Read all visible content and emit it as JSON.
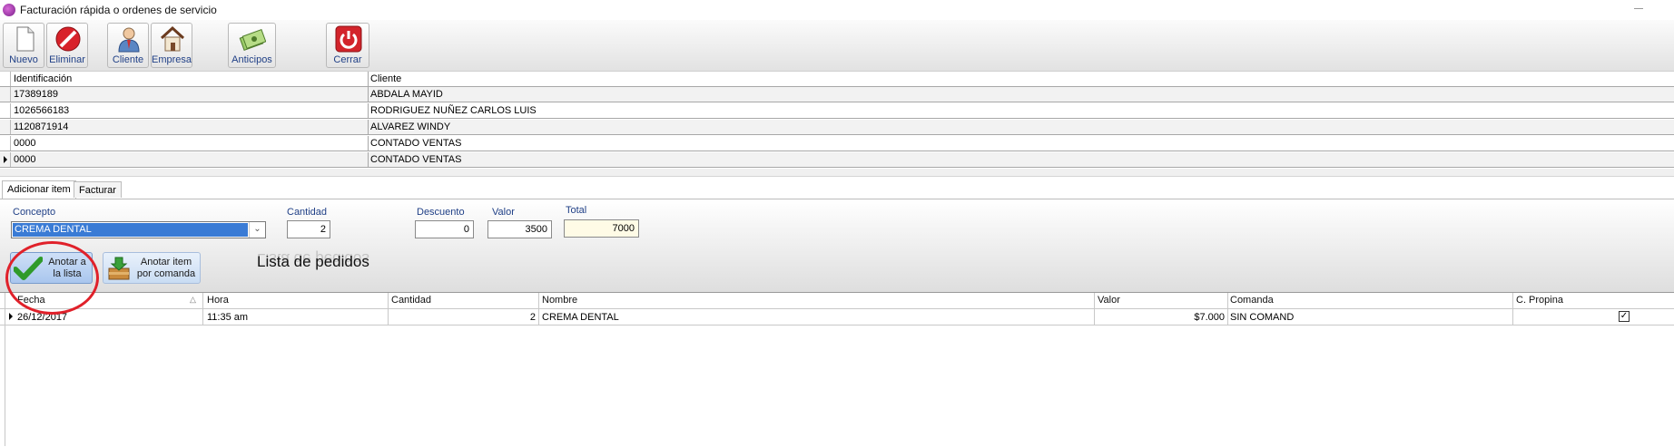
{
  "window": {
    "title": "Facturación rápida o ordenes de servicio"
  },
  "toolbar": {
    "items": [
      {
        "label": "Nuevo",
        "icon": "new-document-icon"
      },
      {
        "label": "Eliminar",
        "icon": "delete-icon"
      },
      {
        "label": "Cliente",
        "icon": "client-icon"
      },
      {
        "label": "Empresa",
        "icon": "company-icon"
      },
      {
        "label": "Anticipos",
        "icon": "money-icon"
      },
      {
        "label": "Cerrar",
        "icon": "power-icon"
      }
    ]
  },
  "clients_grid": {
    "headers": [
      "Identificación",
      "Cliente"
    ],
    "rows": [
      [
        "17389189",
        "ABDALA MAYID"
      ],
      [
        "1026566183",
        "RODRIGUEZ NUÑEZ CARLOS LUIS"
      ],
      [
        "1120871914",
        "ALVAREZ WINDY"
      ],
      [
        "0000",
        "CONTADO VENTAS"
      ],
      [
        "0000",
        "CONTADO VENTAS"
      ]
    ]
  },
  "tabs": [
    "Adicionar item",
    "Facturar"
  ],
  "form": {
    "concepto_label": "Concepto",
    "concepto_value": "CREMA DENTAL",
    "cantidad_label": "Cantidad",
    "cantidad_value": "2",
    "descuento_label": "Descuento",
    "descuento_value": "0",
    "valor_label": "Valor",
    "valor_value": "3500",
    "total_label": "Total",
    "total_value": "7000"
  },
  "actions": {
    "annotate_list": "Anotar a\nla lista",
    "annotate_list_l1": "Anotar a",
    "annotate_list_l2": "la lista",
    "annotate_cmd_l1": "Anotar item",
    "annotate_cmd_l2": "por comanda"
  },
  "orders": {
    "title": "Lista de pedidos",
    "headers": [
      "Fecha",
      "Hora",
      "Cantidad",
      "Nombre",
      "Valor",
      "Comanda",
      "C. Propina"
    ],
    "rows": [
      {
        "fecha": "26/12/2017",
        "hora": "11:35 am",
        "cantidad": "2",
        "nombre": "CREMA DENTAL",
        "valor": "$7.000",
        "comanda": "SIN COMAND",
        "propina": true
      }
    ]
  },
  "colors": {
    "highlight_circle": "#e0212a",
    "selection": "#3a7bd5",
    "label_blue": "#1f3f86"
  }
}
